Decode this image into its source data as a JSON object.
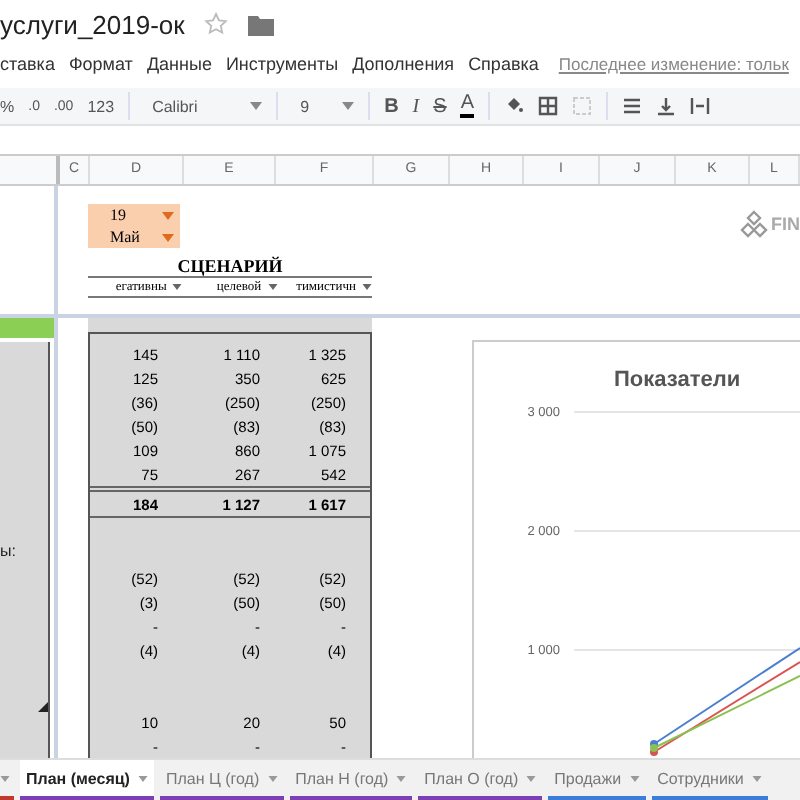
{
  "file_title": "услуги_2019-ок",
  "menu": {
    "items": [
      "ставка",
      "Формат",
      "Данные",
      "Инструменты",
      "Дополнения",
      "Справка"
    ],
    "last_edit": "Последнее изменение: тольк"
  },
  "toolbar": {
    "percent": "%",
    "decimal_less": ".0",
    "decimal_more": ".00",
    "number_format": "123",
    "font": "Calibri",
    "font_size": "9",
    "bold": "B",
    "italic": "I",
    "strike": "S",
    "text_color": "A"
  },
  "column_headers": [
    "C",
    "D",
    "E",
    "F",
    "G",
    "H",
    "I",
    "J",
    "K",
    "L"
  ],
  "date_picker": {
    "day": "19",
    "month": "Май"
  },
  "scenario": {
    "title": "СЦЕНАРИЙ",
    "columns": [
      "егативны",
      "целевой",
      "тимистичн"
    ],
    "rows": [
      {
        "kind": "value",
        "cells": [
          "145",
          "1 110",
          "1 325"
        ]
      },
      {
        "kind": "value",
        "cells": [
          "125",
          "350",
          "625"
        ]
      },
      {
        "kind": "value",
        "cells": [
          "(36)",
          "(250)",
          "(250)"
        ]
      },
      {
        "kind": "value",
        "cells": [
          "(50)",
          "(83)",
          "(83)"
        ]
      },
      {
        "kind": "value",
        "cells": [
          "109",
          "860",
          "1 075"
        ]
      },
      {
        "kind": "value",
        "cells": [
          "75",
          "267",
          "542"
        ]
      },
      {
        "kind": "total",
        "cells": [
          "184",
          "1 127",
          "1 617"
        ]
      },
      {
        "kind": "blank",
        "cells": []
      },
      {
        "kind": "blank",
        "cells": []
      },
      {
        "kind": "value",
        "cells": [
          "(52)",
          "(52)",
          "(52)"
        ]
      },
      {
        "kind": "value",
        "cells": [
          "(3)",
          "(50)",
          "(50)"
        ]
      },
      {
        "kind": "value",
        "cells": [
          "-",
          "-",
          "-"
        ]
      },
      {
        "kind": "value",
        "cells": [
          "(4)",
          "(4)",
          "(4)"
        ]
      },
      {
        "kind": "blank",
        "cells": []
      },
      {
        "kind": "blank",
        "cells": []
      },
      {
        "kind": "value",
        "cells": [
          "10",
          "20",
          "50"
        ]
      },
      {
        "kind": "value",
        "cells": [
          "-",
          "-",
          "-"
        ]
      }
    ]
  },
  "left_panel": {
    "label": "ы:"
  },
  "logo": {
    "text": "FIN"
  },
  "chart": {
    "title": "Показатели",
    "y_axis_labels": [
      "3 000",
      "2 000",
      "1 000"
    ]
  },
  "sheet_tabs": [
    {
      "selected": false,
      "color": "#c0392b"
    },
    {
      "label": "План (месяц)",
      "selected": true,
      "color": "#7e3fb5"
    },
    {
      "label": "План Ц (год)",
      "selected": false,
      "color": "#7e3fb5"
    },
    {
      "label": "План Н (год)",
      "selected": false,
      "color": "#7e3fb5"
    },
    {
      "label": "План О (год)",
      "selected": false,
      "color": "#7e3fb5"
    },
    {
      "label": "Продажи",
      "selected": false,
      "color": "#3b7dd8"
    },
    {
      "label": "Сотрудники",
      "selected": false,
      "color": "#3b7dd8"
    }
  ]
}
